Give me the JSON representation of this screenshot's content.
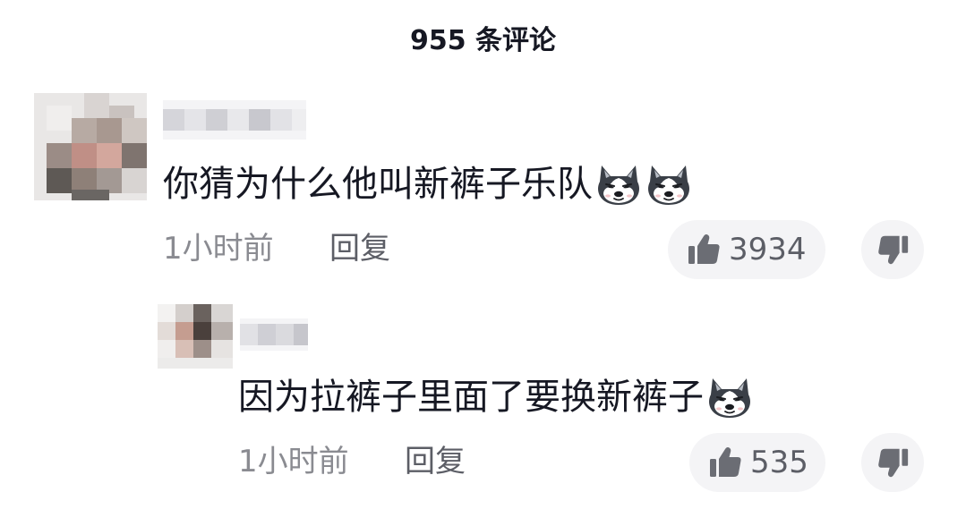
{
  "header": {
    "title": "955 条评论"
  },
  "comments": [
    {
      "text": "你猜为什么他叫新裤子乐队",
      "emoji_count": 2,
      "emoji_icon": "husky-dog-emoji-icon",
      "time": "1小时前",
      "reply_label": "回复",
      "likes": "3934"
    },
    {
      "text": "因为拉裤子里面了要换新裤子",
      "emoji_count": 1,
      "emoji_icon": "husky-dog-emoji-icon",
      "time": "1小时前",
      "reply_label": "回复",
      "likes": "535"
    }
  ],
  "colors": {
    "text_primary": "#161823",
    "text_meta": "#8a8b91",
    "text_secondary": "#5c5e66",
    "pill_bg": "#f4f4f6",
    "icon_gray": "#6b6d74"
  }
}
